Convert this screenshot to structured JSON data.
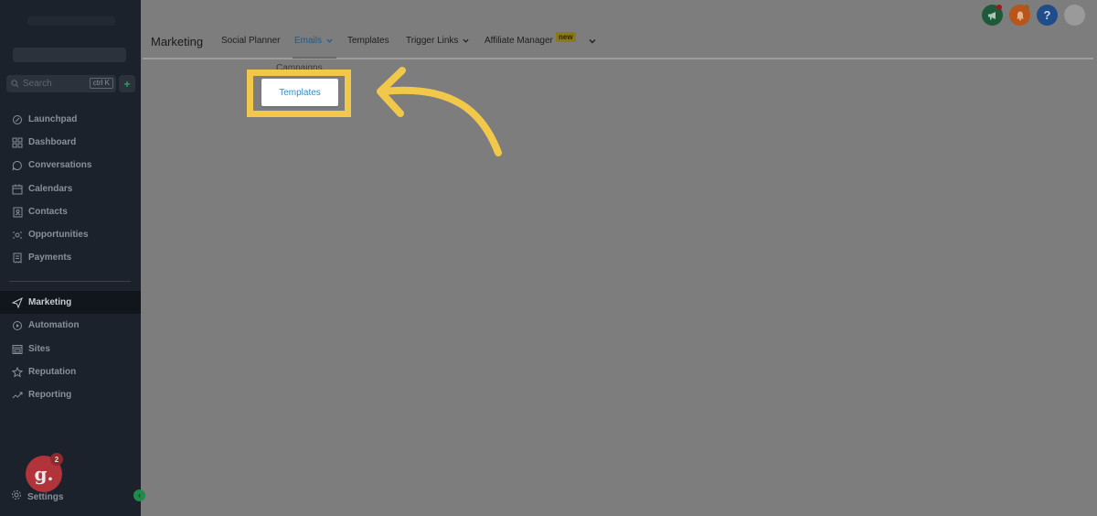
{
  "sidebar": {
    "search": {
      "placeholder": "Search",
      "shortcut": "ctrl K",
      "quick_action": "+"
    },
    "items": [
      {
        "label": "Launchpad",
        "icon": "rocket-icon"
      },
      {
        "label": "Dashboard",
        "icon": "dashboard-grid-icon"
      },
      {
        "label": "Conversations",
        "icon": "chat-bubble-icon"
      },
      {
        "label": "Calendars",
        "icon": "calendar-icon"
      },
      {
        "label": "Contacts",
        "icon": "contacts-book-icon"
      },
      {
        "label": "Opportunities",
        "icon": "opportunities-icon"
      },
      {
        "label": "Payments",
        "icon": "receipt-icon"
      },
      {
        "label": "Marketing",
        "icon": "paper-plane-icon",
        "active": true
      },
      {
        "label": "Automation",
        "icon": "automation-icon"
      },
      {
        "label": "Sites",
        "icon": "sites-icon"
      },
      {
        "label": "Reputation",
        "icon": "star-icon"
      },
      {
        "label": "Reporting",
        "icon": "trend-line-icon"
      }
    ],
    "avatar_letter": "g.",
    "avatar_badge": "2",
    "settings_label": "Settings",
    "collapse_glyph": "‹"
  },
  "topbar": {
    "help_label": "?"
  },
  "header": {
    "title": "Marketing",
    "tabs": [
      {
        "label": "Social Planner",
        "dropdown": false
      },
      {
        "label": "Emails",
        "dropdown": true,
        "active": true
      },
      {
        "label": "Templates",
        "dropdown": false
      },
      {
        "label": "Trigger Links",
        "dropdown": true
      },
      {
        "label": "Affiliate Manager",
        "dropdown": false,
        "badge": "new"
      }
    ]
  },
  "dropdown": {
    "partial_item": "Campaigns",
    "highlighted_item": "Templates"
  },
  "colors": {
    "sidebar_bg": "#1b222c",
    "overlay_bg": "#7d7d7d",
    "highlight": "#f2c84b",
    "link_blue": "#2a8fd0"
  }
}
